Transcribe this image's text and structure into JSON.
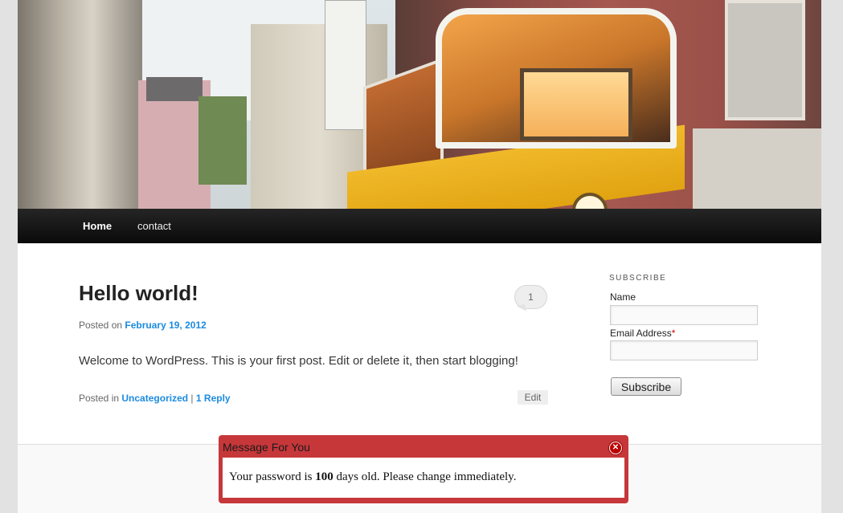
{
  "nav": {
    "home": "Home",
    "contact": "contact"
  },
  "post": {
    "title": "Hello world!",
    "comment_count": "1",
    "posted_on_prefix": "Posted on",
    "date": "February 19, 2012",
    "content": "Welcome to WordPress. This is your first post. Edit or delete it, then start blogging!",
    "posted_in_prefix": "Posted in",
    "category": "Uncategorized",
    "separator": "|",
    "reply_link": "1 Reply",
    "edit_label": "Edit"
  },
  "widget": {
    "title": "SUBSCRIBE",
    "name_label": "Name",
    "email_label": "Email Address",
    "required_mark": "*",
    "button_label": "Subscribe"
  },
  "modal": {
    "title": "Message For You",
    "close_icon": "close-icon",
    "message_before": "Your password is",
    "message_days": "100",
    "message_after": "days old. Please change immediately."
  },
  "colors": {
    "link": "#1b8be0",
    "modal": "#c6373a",
    "nav": "#111111"
  }
}
